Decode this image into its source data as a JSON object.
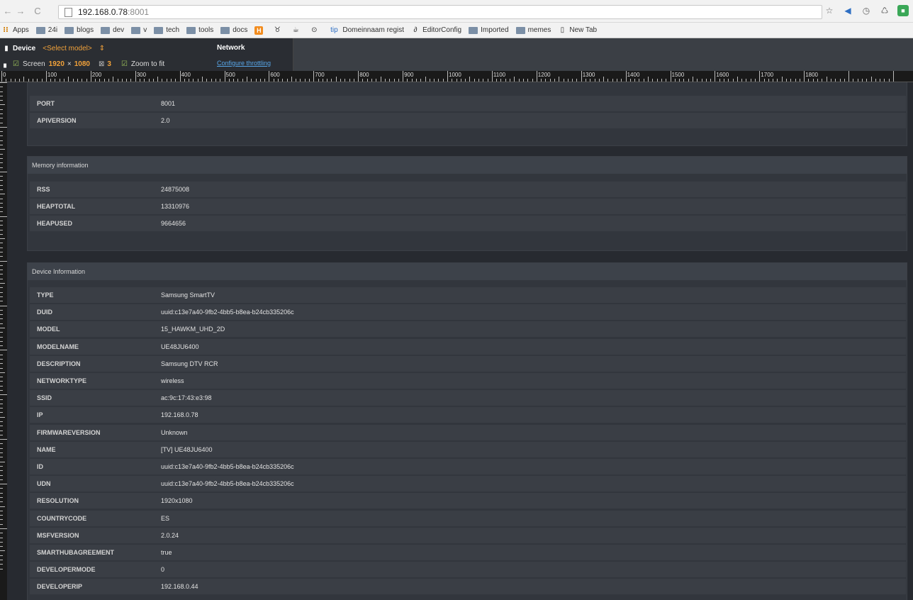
{
  "browser": {
    "url_host": "192.168.0.78",
    "url_port": ":8001",
    "bookmarks": [
      "Apps",
      "24i",
      "blogs",
      "dev",
      "v",
      "tech",
      "tools",
      "docs",
      "Domeinnaam regist",
      "EditorConfig",
      "Imported",
      "memes",
      "New Tab"
    ]
  },
  "devtools": {
    "device_label": "Device",
    "model_select": "<Select model>",
    "screen_label": "Screen",
    "screen_width": "1920",
    "screen_x": "×",
    "screen_height": "1080",
    "dpr": "3",
    "zoom_label": "Zoom to fit",
    "network_title": "Network",
    "network_link": "Configure throttling"
  },
  "ruler": [
    "0",
    "100",
    "200",
    "300",
    "400",
    "500",
    "600",
    "700",
    "800",
    "900",
    "1000",
    "1100",
    "1200",
    "1300",
    "1400",
    "1500",
    "1600",
    "1700",
    "1800"
  ],
  "top_section": {
    "rows": [
      {
        "key": "PORT",
        "value": "8001"
      },
      {
        "key": "APIVERSION",
        "value": "2.0"
      }
    ]
  },
  "memory": {
    "title": "Memory information",
    "rows": [
      {
        "key": "RSS",
        "value": "24875008"
      },
      {
        "key": "HEAPTOTAL",
        "value": "13310976"
      },
      {
        "key": "HEAPUSED",
        "value": "9664656"
      }
    ]
  },
  "device": {
    "title": "Device Information",
    "rows": [
      {
        "key": "TYPE",
        "value": "Samsung SmartTV"
      },
      {
        "key": "DUID",
        "value": "uuid:c13e7a40-9fb2-4bb5-b8ea-b24cb335206c"
      },
      {
        "key": "MODEL",
        "value": "15_HAWKM_UHD_2D"
      },
      {
        "key": "MODELNAME",
        "value": "UE48JU6400"
      },
      {
        "key": "DESCRIPTION",
        "value": "Samsung DTV RCR"
      },
      {
        "key": "NETWORKTYPE",
        "value": "wireless"
      },
      {
        "key": "SSID",
        "value": "ac:9c:17:43:e3:98"
      },
      {
        "key": "IP",
        "value": "192.168.0.78"
      },
      {
        "key": "FIRMWAREVERSION",
        "value": "Unknown"
      },
      {
        "key": "NAME",
        "value": "[TV] UE48JU6400"
      },
      {
        "key": "ID",
        "value": "uuid:c13e7a40-9fb2-4bb5-b8ea-b24cb335206c"
      },
      {
        "key": "UDN",
        "value": "uuid:c13e7a40-9fb2-4bb5-b8ea-b24cb335206c"
      },
      {
        "key": "RESOLUTION",
        "value": "1920x1080"
      },
      {
        "key": "COUNTRYCODE",
        "value": "ES"
      },
      {
        "key": "MSFVERSION",
        "value": "2.0.24"
      },
      {
        "key": "SMARTHUBAGREEMENT",
        "value": "true"
      },
      {
        "key": "DEVELOPERMODE",
        "value": "0"
      },
      {
        "key": "DEVELOPERIP",
        "value": "192.168.0.44"
      }
    ]
  }
}
